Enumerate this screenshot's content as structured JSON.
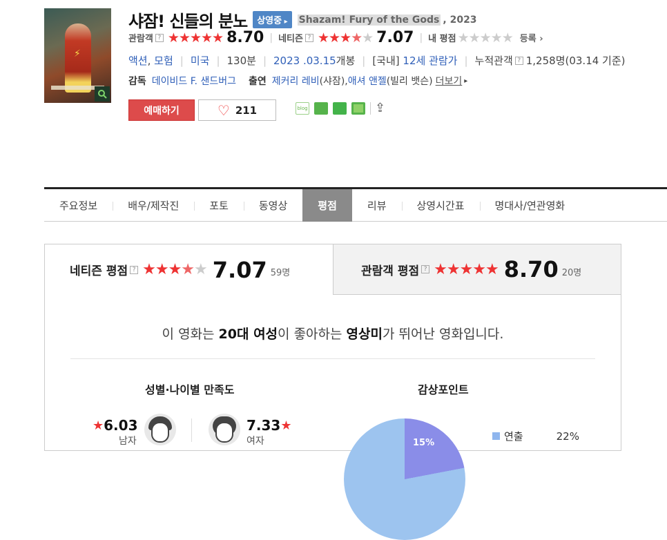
{
  "movie": {
    "title": "샤잠! 신들의 분노",
    "status_badge": "상영중",
    "english_title": "Shazam! Fury of the Gods",
    "year": ", 2023"
  },
  "ratings": {
    "audience_label": "관람객",
    "audience_score": "8.70",
    "netizen_label": "네티즌",
    "netizen_score": "7.07",
    "my_rating_label": "내 평점",
    "register_label": "등록"
  },
  "info": {
    "genre1": "액션",
    "genre2": "모험",
    "country": "미국",
    "runtime": "130분",
    "release_date": "2023 .03.15",
    "release_suffix": " 개봉",
    "rating_prefix": "[국내] ",
    "rating": "12세 관람가",
    "cumulative_label": "누적관객",
    "cumulative_value": "1,258명(03.14 기준)"
  },
  "credits": {
    "director_label": "감독",
    "director": "데이비드 F. 샌드버그",
    "cast_label": "출연",
    "actor1": "제커리 레비",
    "role1": "(샤잠), ",
    "actor2": "애셔 앤젤",
    "role2": "(빌리 뱃슨)",
    "more_label": "더보기"
  },
  "actions": {
    "book_label": "예매하기",
    "like_count": "211",
    "share_icons": [
      "blog-icon",
      "cafe-icon",
      "bookmark-icon",
      "memo-icon",
      "share-icon"
    ]
  },
  "tabs": [
    "주요정보",
    "배우/제작진",
    "포토",
    "동영상",
    "평점",
    "리뷰",
    "상영시간표",
    "명대사/연관영화"
  ],
  "active_tab": "평점",
  "score_panel": {
    "netizen_label": "네티즌 평점",
    "netizen_score": "7.07",
    "netizen_count": "59명",
    "audience_label": "관람객 평점",
    "audience_score": "8.70",
    "audience_count": "20명"
  },
  "summary": {
    "prefix": "이 영화는 ",
    "group": "20대 여성",
    "mid": "이 좋아하는 ",
    "point": "영상미",
    "suffix": "가 뛰어난 영화입니다."
  },
  "gender_section": {
    "title": "성별·나이별 만족도",
    "male_score": "6.03",
    "male_label": "남자",
    "female_score": "7.33",
    "female_label": "여자"
  },
  "points_section": {
    "title": "감상포인트",
    "pie_label": "15%",
    "legend_label": "연출",
    "legend_pct": "22%"
  },
  "colors": {
    "accent_red": "#dd4b4b",
    "link_blue": "#2f5fb8",
    "badge_blue": "#4f86c6"
  }
}
